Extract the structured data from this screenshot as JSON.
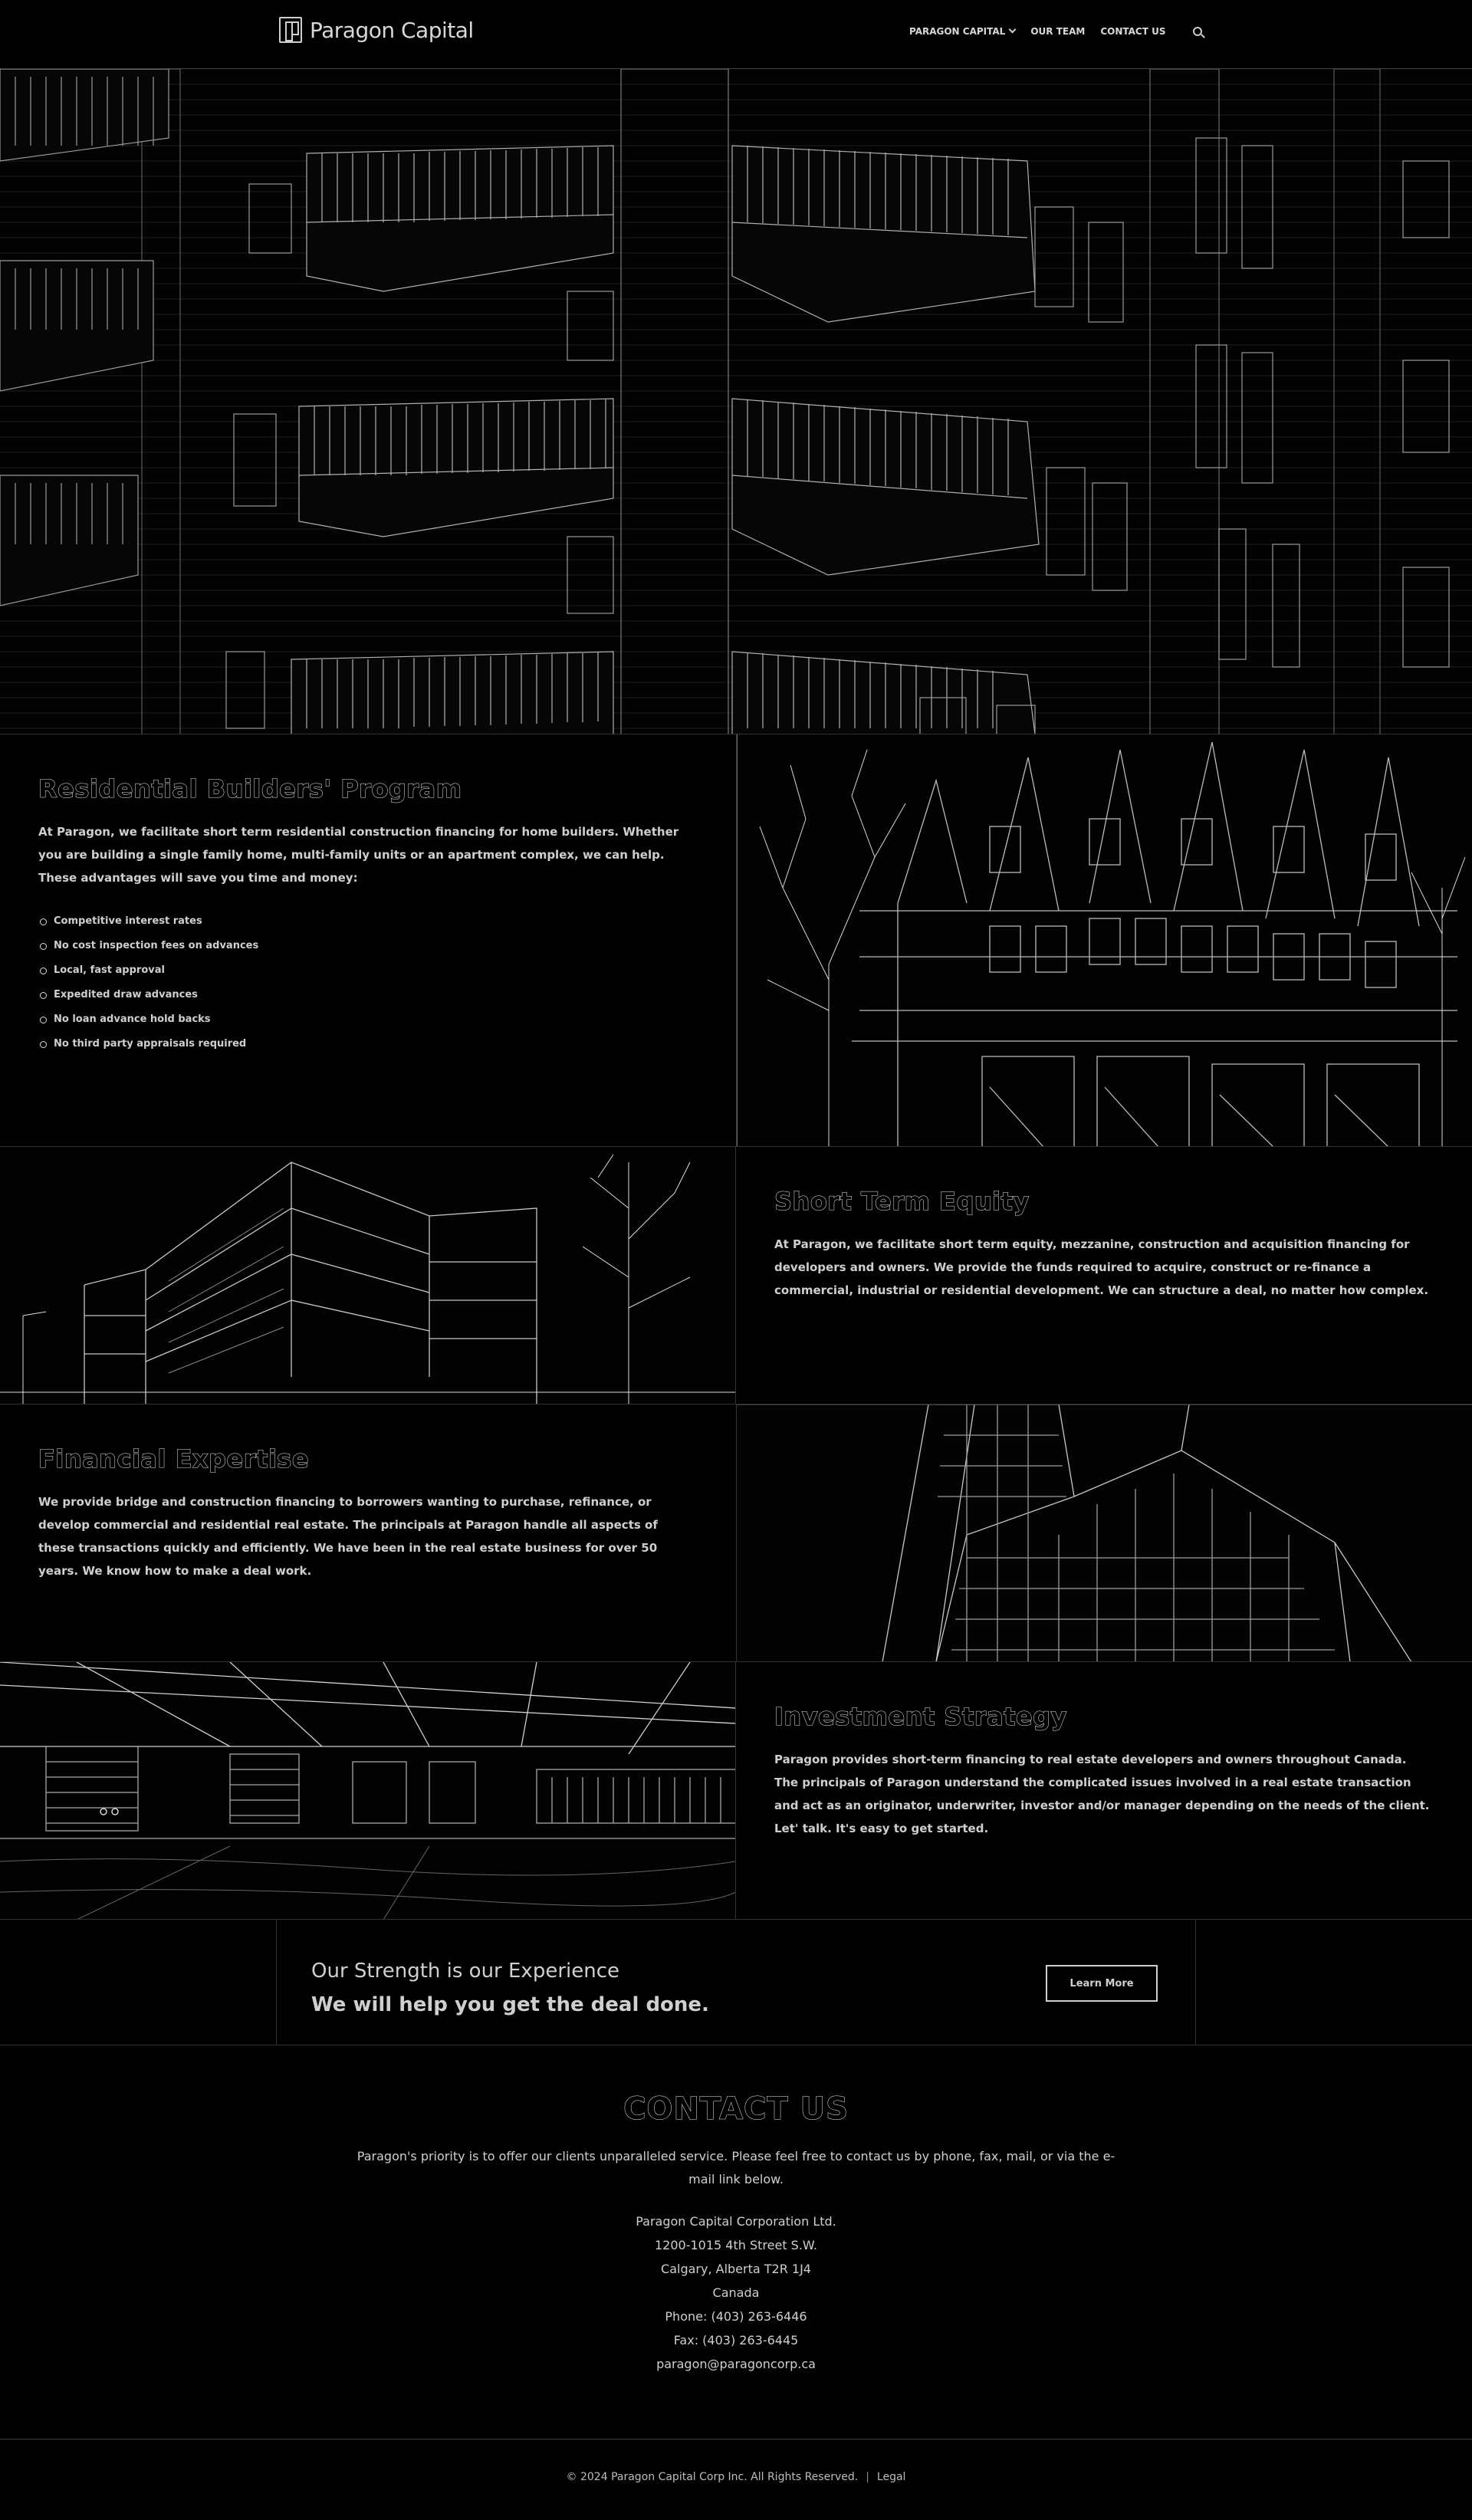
{
  "header": {
    "logo_text": "Paragon Capital",
    "nav": {
      "item1": "PARAGON CAPITAL",
      "item2": "OUR TEAM",
      "item3": "CONTACT US"
    }
  },
  "sections": {
    "residential": {
      "title": "Residential Builders' Program",
      "body": "At Paragon, we facilitate short term residential construction financing for home builders.  Whether you are building a single family home, multi-family units or an apartment complex, we can help. These advantages will save you time and money:",
      "bullets": [
        "Competitive interest rates",
        "No cost inspection fees on advances",
        "Local, fast approval",
        "Expedited draw advances",
        "No loan advance hold backs",
        "No third party appraisals required"
      ]
    },
    "equity": {
      "title": "Short Term Equity",
      "body": "At Paragon, we facilitate short term equity, mezzanine, construction and acquisition financing for developers and owners. We provide the funds required to acquire, construct or re-finance a commercial, industrial or residential development. We can structure a deal, no matter how complex."
    },
    "expertise": {
      "title": "Financial Expertise",
      "body": "We provide bridge and construction financing to borrowers wanting to purchase, refinance, or develop commercial and residential real estate. The principals at Paragon handle all aspects of these transactions quickly and efficiently. We have been in the real estate business for over 50 years. We know how to make a deal work."
    },
    "investment": {
      "title": "Investment Strategy",
      "body": "Paragon provides short-term financing to real estate developers and owners throughout Canada. The principals of Paragon understand the complicated issues involved in a real estate transaction and act as an originator, underwriter, investor and/or manager depending on the needs of the client. Let' talk. It's easy to get started."
    }
  },
  "cta": {
    "line1": "Our Strength is our Experience",
    "line2": "We will help you get the deal done.",
    "button": "Learn More"
  },
  "contact": {
    "title": "CONTACT US",
    "intro": "Paragon's priority is to offer our clients unparalleled service. Please feel free to contact us by phone, fax, mail, or via the e-mail link below.",
    "company": "Paragon Capital Corporation Ltd.",
    "street": "1200-1015 4th Street S.W.",
    "city": "Calgary, Alberta T2R 1J4",
    "country": "Canada",
    "phone": "Phone: (403) 263-6446",
    "fax": "Fax: (403) 263-6445",
    "email": "paragon@paragoncorp.ca"
  },
  "footer": {
    "copyright": "© 2024 Paragon Capital Corp Inc. All Rights Reserved.",
    "separator": "|",
    "legal": "Legal"
  }
}
